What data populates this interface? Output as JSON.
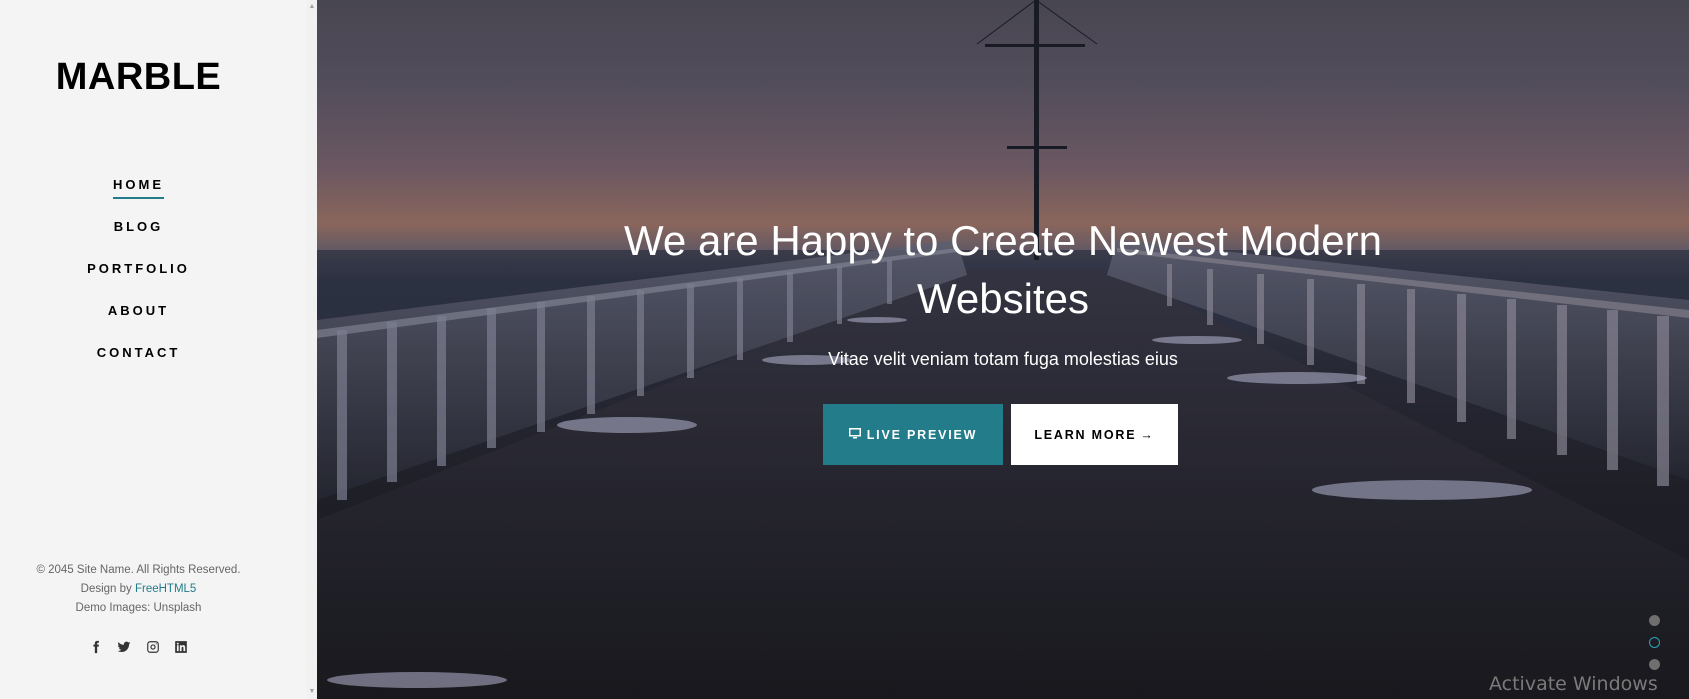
{
  "sidebar": {
    "brand": "MARBLE",
    "nav": [
      {
        "label": "HOME",
        "active": true
      },
      {
        "label": "BLOG",
        "active": false
      },
      {
        "label": "PORTFOLIO",
        "active": false
      },
      {
        "label": "ABOUT",
        "active": false
      },
      {
        "label": "CONTACT",
        "active": false
      }
    ],
    "footer": {
      "copyright": "© 2045 Site Name. All Rights Reserved.",
      "design_prefix": "Design by ",
      "design_link": "FreeHTML5",
      "images_credit": "Demo Images: Unsplash"
    },
    "socials": [
      "facebook-icon",
      "twitter-icon",
      "instagram-icon",
      "linkedin-icon"
    ]
  },
  "hero": {
    "title": "We are Happy to Create Newest Modern Websites",
    "subtitle": "Vitae velit veniam totam fuga molestias eius",
    "buttons": {
      "primary": {
        "label": "LIVE PREVIEW",
        "icon": "monitor-icon"
      },
      "secondary": {
        "label": "LEARN MORE",
        "icon": "arrow-right-icon"
      }
    },
    "slider": {
      "count": 3,
      "active_index": 1
    }
  },
  "overlay": {
    "watermark": "Activate Windows"
  },
  "colors": {
    "accent": "#237c8a",
    "sidebar_bg": "#f4f4f4",
    "text": "#000000"
  }
}
